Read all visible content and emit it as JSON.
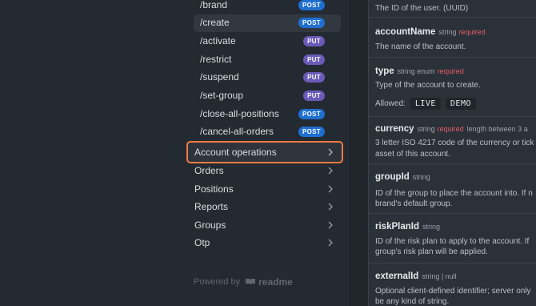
{
  "sidebar": {
    "endpoints": [
      {
        "path": "/brand",
        "method": "POST",
        "active": false
      },
      {
        "path": "/create",
        "method": "POST",
        "active": true
      },
      {
        "path": "/activate",
        "method": "PUT",
        "active": false
      },
      {
        "path": "/restrict",
        "method": "PUT",
        "active": false
      },
      {
        "path": "/suspend",
        "method": "PUT",
        "active": false
      },
      {
        "path": "/set-group",
        "method": "PUT",
        "active": false
      },
      {
        "path": "/close-all-positions",
        "method": "POST",
        "active": false
      },
      {
        "path": "/cancel-all-orders",
        "method": "POST",
        "active": false
      }
    ],
    "groups": [
      {
        "label": "Account operations",
        "focused": true
      },
      {
        "label": "Orders",
        "focused": false
      },
      {
        "label": "Positions",
        "focused": false
      },
      {
        "label": "Reports",
        "focused": false
      },
      {
        "label": "Groups",
        "focused": false
      },
      {
        "label": "Otp",
        "focused": false
      }
    ],
    "powered_by": "Powered by",
    "brand": "readme"
  },
  "params": {
    "items": [
      {
        "name": "",
        "type": "",
        "required": "",
        "extra": "",
        "desc": [
          "The ID of the user. (UUID)"
        ]
      },
      {
        "name": "accountName",
        "type": "string",
        "required": "required",
        "extra": "",
        "desc": [
          "The name of the account."
        ]
      },
      {
        "name": "type",
        "type": "string enum",
        "required": "required",
        "extra": "",
        "desc": [
          "Type of the account to create."
        ],
        "allowed_label": "Allowed:",
        "allowed": [
          "LIVE",
          "DEMO"
        ]
      },
      {
        "name": "currency",
        "type": "string",
        "required": "required",
        "extra": "length between 3 a",
        "desc": [
          "3 letter ISO 4217 code of the currency or tick",
          "asset of this account."
        ]
      },
      {
        "name": "groupId",
        "type": "string",
        "required": "",
        "extra": "",
        "desc": [
          "ID of the group to place the account into. If n",
          "brand's default group."
        ]
      },
      {
        "name": "riskPlanId",
        "type": "string",
        "required": "",
        "extra": "",
        "desc": [
          "ID of the risk plan to apply to the account. If",
          "group's risk plan will be applied."
        ]
      },
      {
        "name": "externalId",
        "type": "string | null",
        "required": "",
        "extra": "",
        "desc": [
          "Optional client-defined identifier; server only",
          "be any kind of string."
        ]
      }
    ]
  },
  "colors": {
    "post": "#1f6fd0",
    "put": "#6b5bb8",
    "required": "#e35d6a",
    "focus_ring": "#ee7a46"
  }
}
